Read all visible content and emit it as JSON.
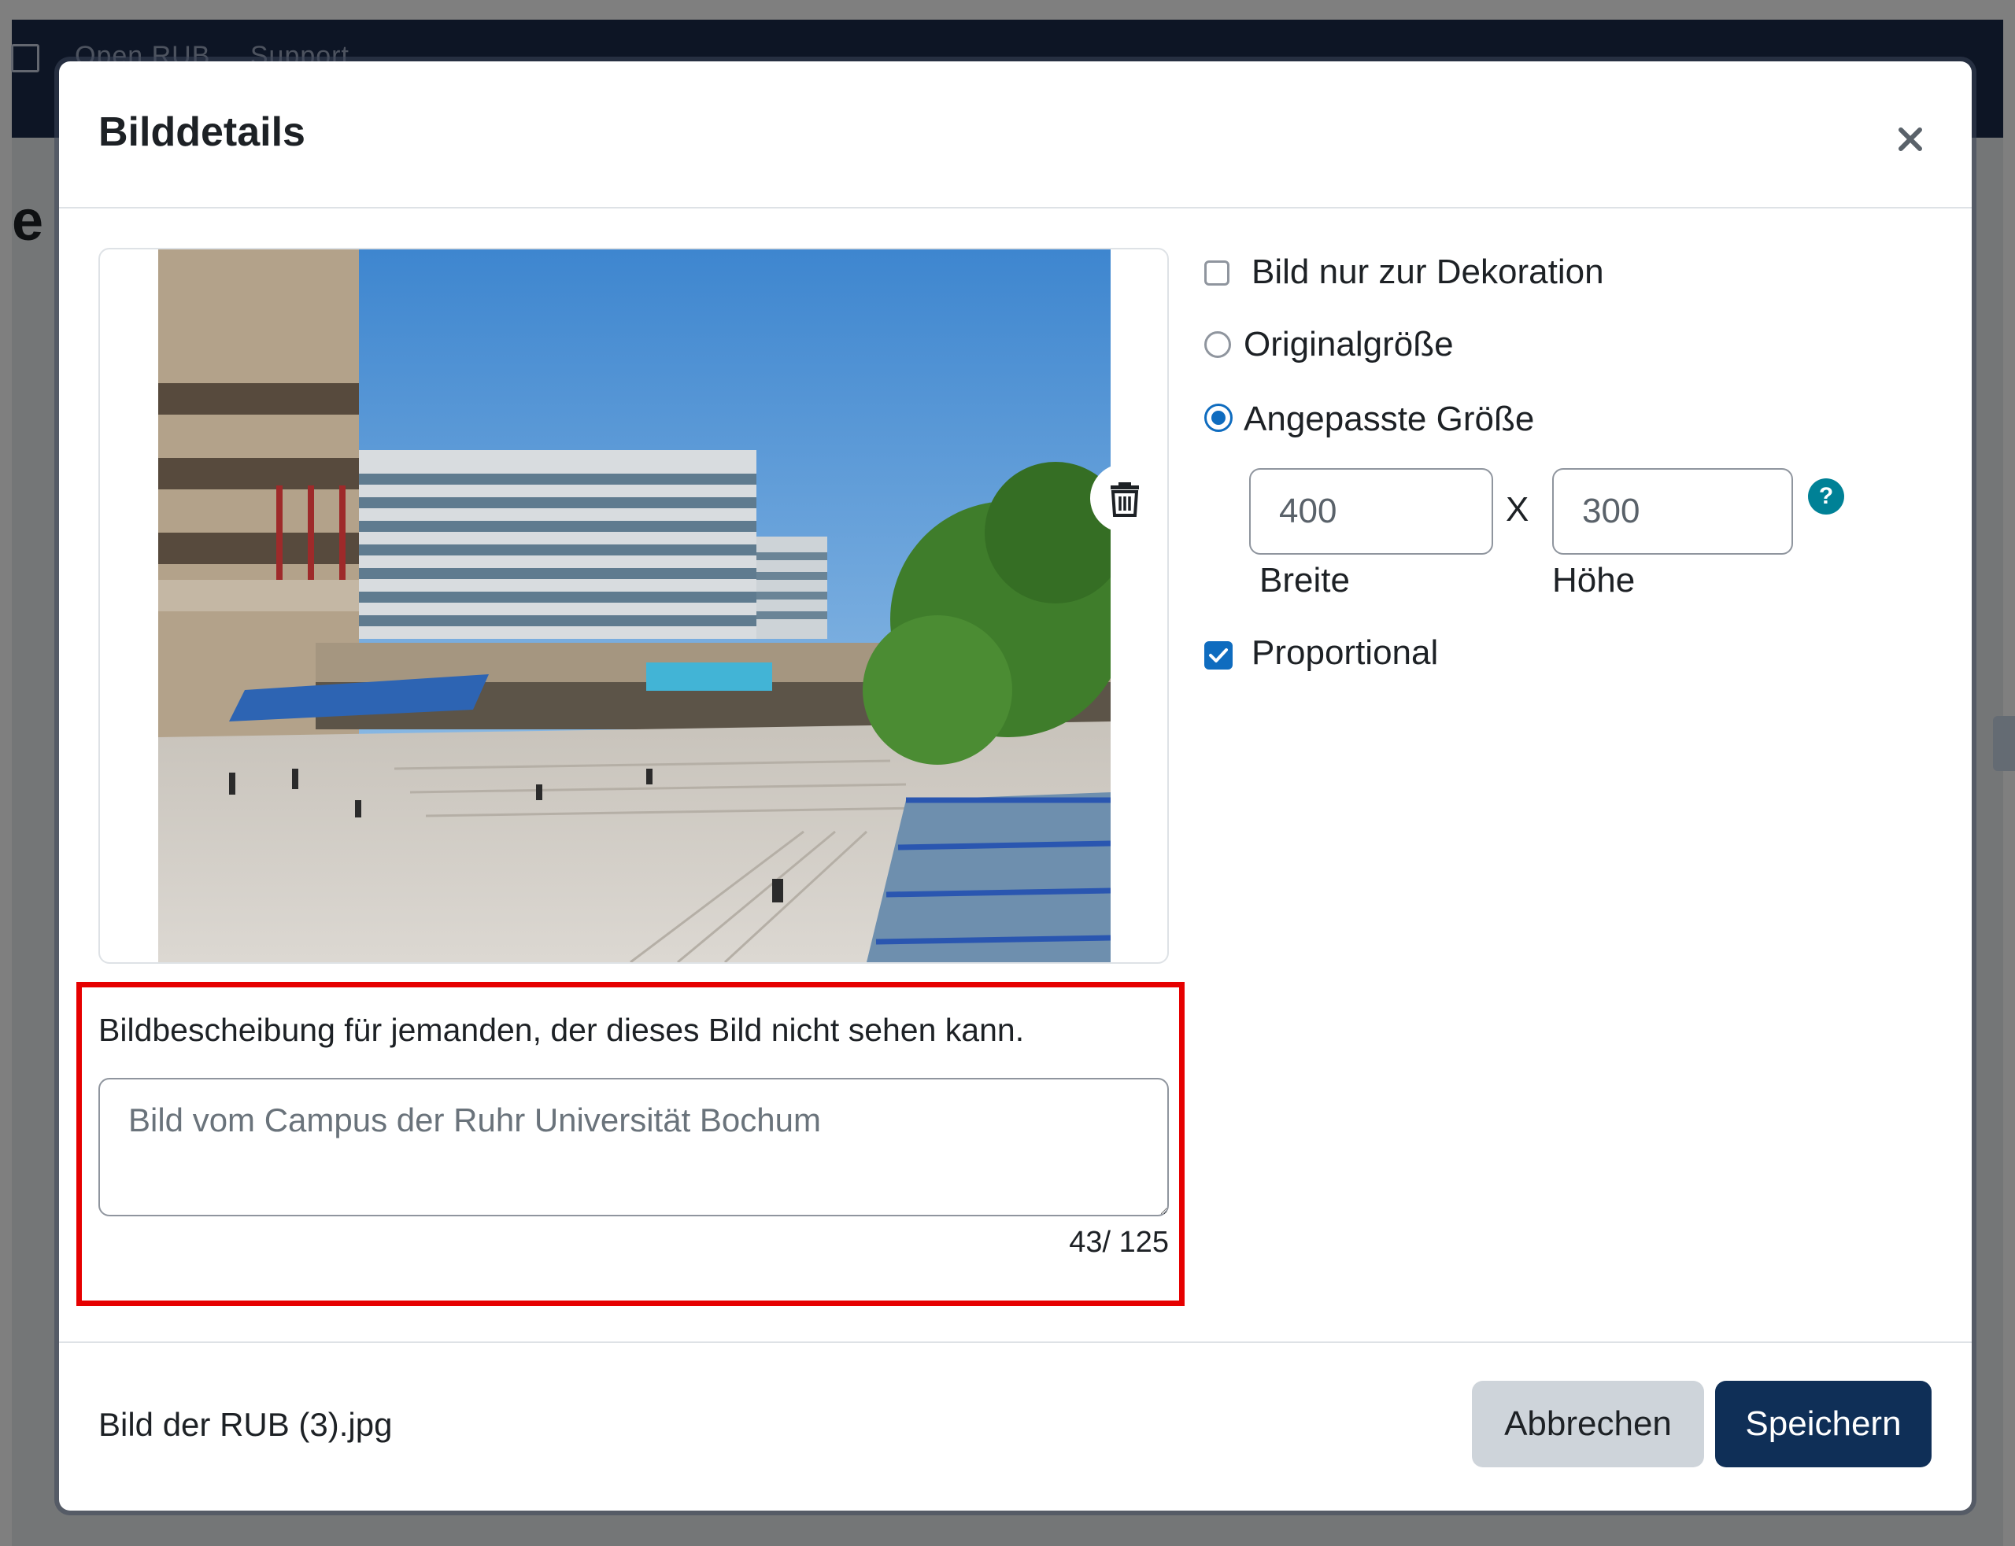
{
  "background": {
    "nav_links": [
      "Open RUB",
      "Support"
    ]
  },
  "dialog": {
    "title": "Bilddetails",
    "close_label": "×"
  },
  "image_preview": {
    "alt": "Bild vom Campus der Ruhr Universität Bochum"
  },
  "options": {
    "decorative_label": "Bild nur zur Dekoration",
    "decorative_checked": false,
    "original_size_label": "Originalgröße",
    "custom_size_label": "Angepasste Größe",
    "custom_size_selected": true,
    "width_value": "400",
    "height_value": "300",
    "separator": "X",
    "width_label": "Breite",
    "height_label": "Höhe",
    "help_icon": "?",
    "proportional_label": "Proportional",
    "proportional_checked": true
  },
  "alt_text": {
    "label": "Bildbescheibung für jemanden, der dieses Bild nicht sehen kann.",
    "value": "Bild vom Campus der Ruhr Universität Bochum",
    "char_count": "43/ 125"
  },
  "footer": {
    "filename": "Bild der RUB (3).jpg",
    "cancel_label": "Abbrechen",
    "save_label": "Speichern"
  },
  "colors": {
    "primary": "#0f6cbf",
    "save_button": "#0f2f57",
    "highlight": "#e60000",
    "help_icon": "#008196"
  }
}
